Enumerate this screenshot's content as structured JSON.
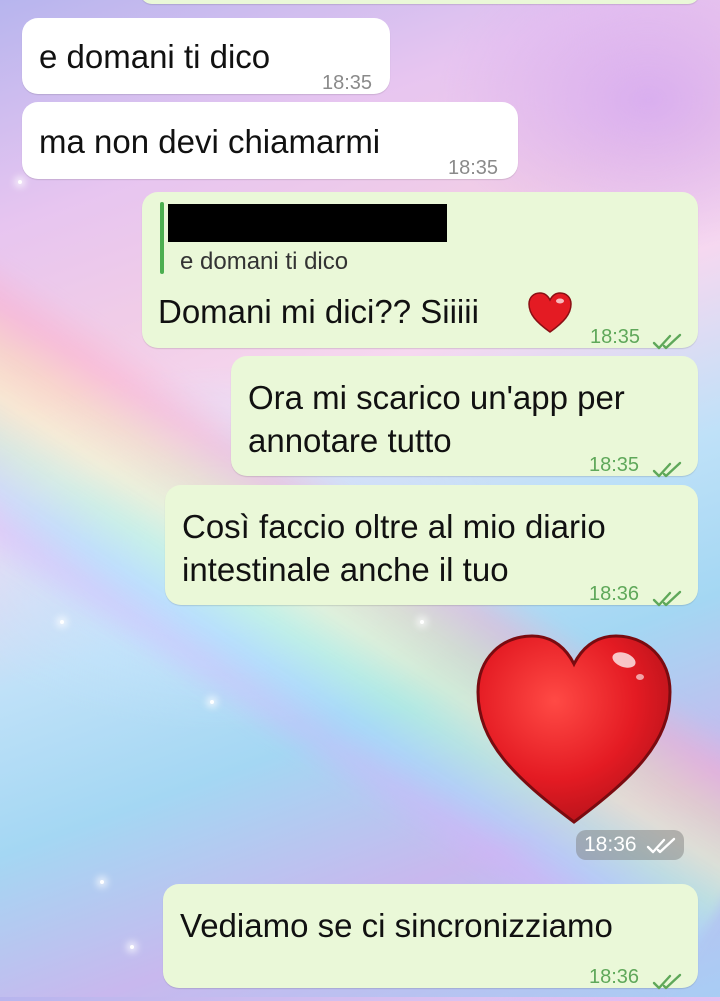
{
  "background": {
    "style": "pastel galaxy rainbow wallpaper"
  },
  "colors": {
    "incoming_bubble": "#ffffff",
    "outgoing_bubble": "#eaf8d8",
    "tick_color": "#5fa85a",
    "quote_bar": "#4caf50",
    "heart": "#e41b23"
  },
  "messages": [
    {
      "id": "m1",
      "direction": "incoming",
      "text": "e domani ti dico",
      "time": "18:35"
    },
    {
      "id": "m2",
      "direction": "incoming",
      "text": "ma non devi chiamarmi",
      "time": "18:35"
    },
    {
      "id": "m3",
      "direction": "outgoing",
      "quote": {
        "author": "[redacted]",
        "text": "e domani ti dico"
      },
      "text": "Domani mi dici?? Siiiii",
      "emoji": "heart-emoji",
      "time": "18:35",
      "status": "read-double-tick-icon"
    },
    {
      "id": "m4",
      "direction": "outgoing",
      "text": "Ora mi scarico un'app per\nannotare tutto",
      "time": "18:35",
      "status": "read-double-tick-icon"
    },
    {
      "id": "m5",
      "direction": "outgoing",
      "text": "Così faccio oltre al mio diario\nintestinale anche il tuo",
      "time": "18:36",
      "status": "read-double-tick-icon"
    },
    {
      "id": "m6",
      "direction": "outgoing",
      "sticker": "large-heart-emoji",
      "time": "18:36",
      "status": "read-double-tick-icon"
    },
    {
      "id": "m7",
      "direction": "outgoing",
      "text": "Vediamo se ci sincronizziamo",
      "time": "18:36",
      "status": "read-double-tick-icon"
    }
  ]
}
